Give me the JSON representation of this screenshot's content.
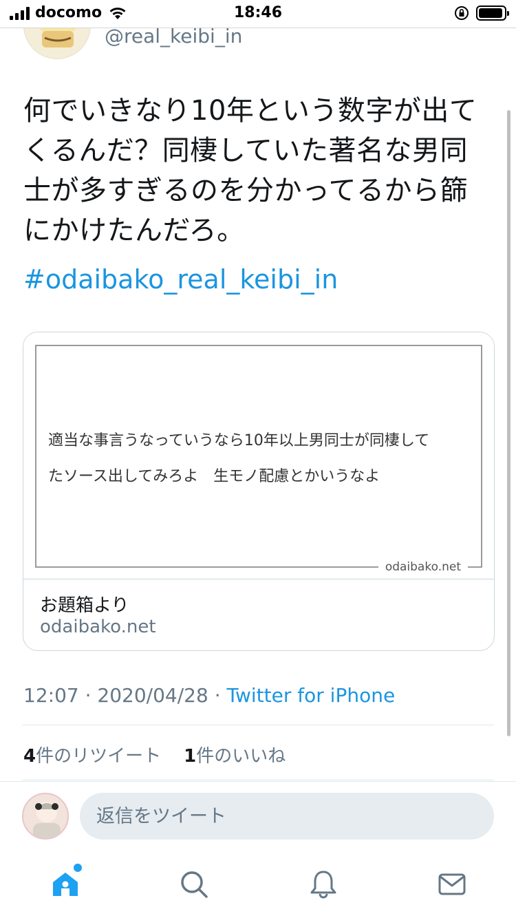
{
  "status_bar": {
    "carrier": "docomo",
    "time": "18:46"
  },
  "author": {
    "handle": "@real_keibi_in"
  },
  "tweet": {
    "text": "何でいきなり10年という数字が出て\nくるんだ？同棲していた著名な男同\n士が多すぎるのを分かってるから篩\nにかけたんだろ。",
    "hashtag": "#odaibako_real_keibi_in",
    "card": {
      "quote": "適当な事言うなっていうなら10年以上男同士が同棲して\nたソース出してみろよ　生モノ配慮とかいうなよ",
      "image_domain": "odaibako.net",
      "title": "お題箱より",
      "site": "odaibako.net"
    },
    "time": "12:07",
    "separator": "·",
    "date": "2020/04/28",
    "via": "Twitter for iPhone",
    "retweet_count": "4",
    "retweet_label": "件のリツイート",
    "like_count": "1",
    "like_label": "件のいいね"
  },
  "composer": {
    "placeholder": "返信をツイート"
  },
  "tabs": [
    "home-icon",
    "search-icon",
    "bell-icon",
    "mail-icon"
  ],
  "colors": {
    "accent": "#1da1f2",
    "link": "#1b95e0",
    "muted": "#657786"
  }
}
